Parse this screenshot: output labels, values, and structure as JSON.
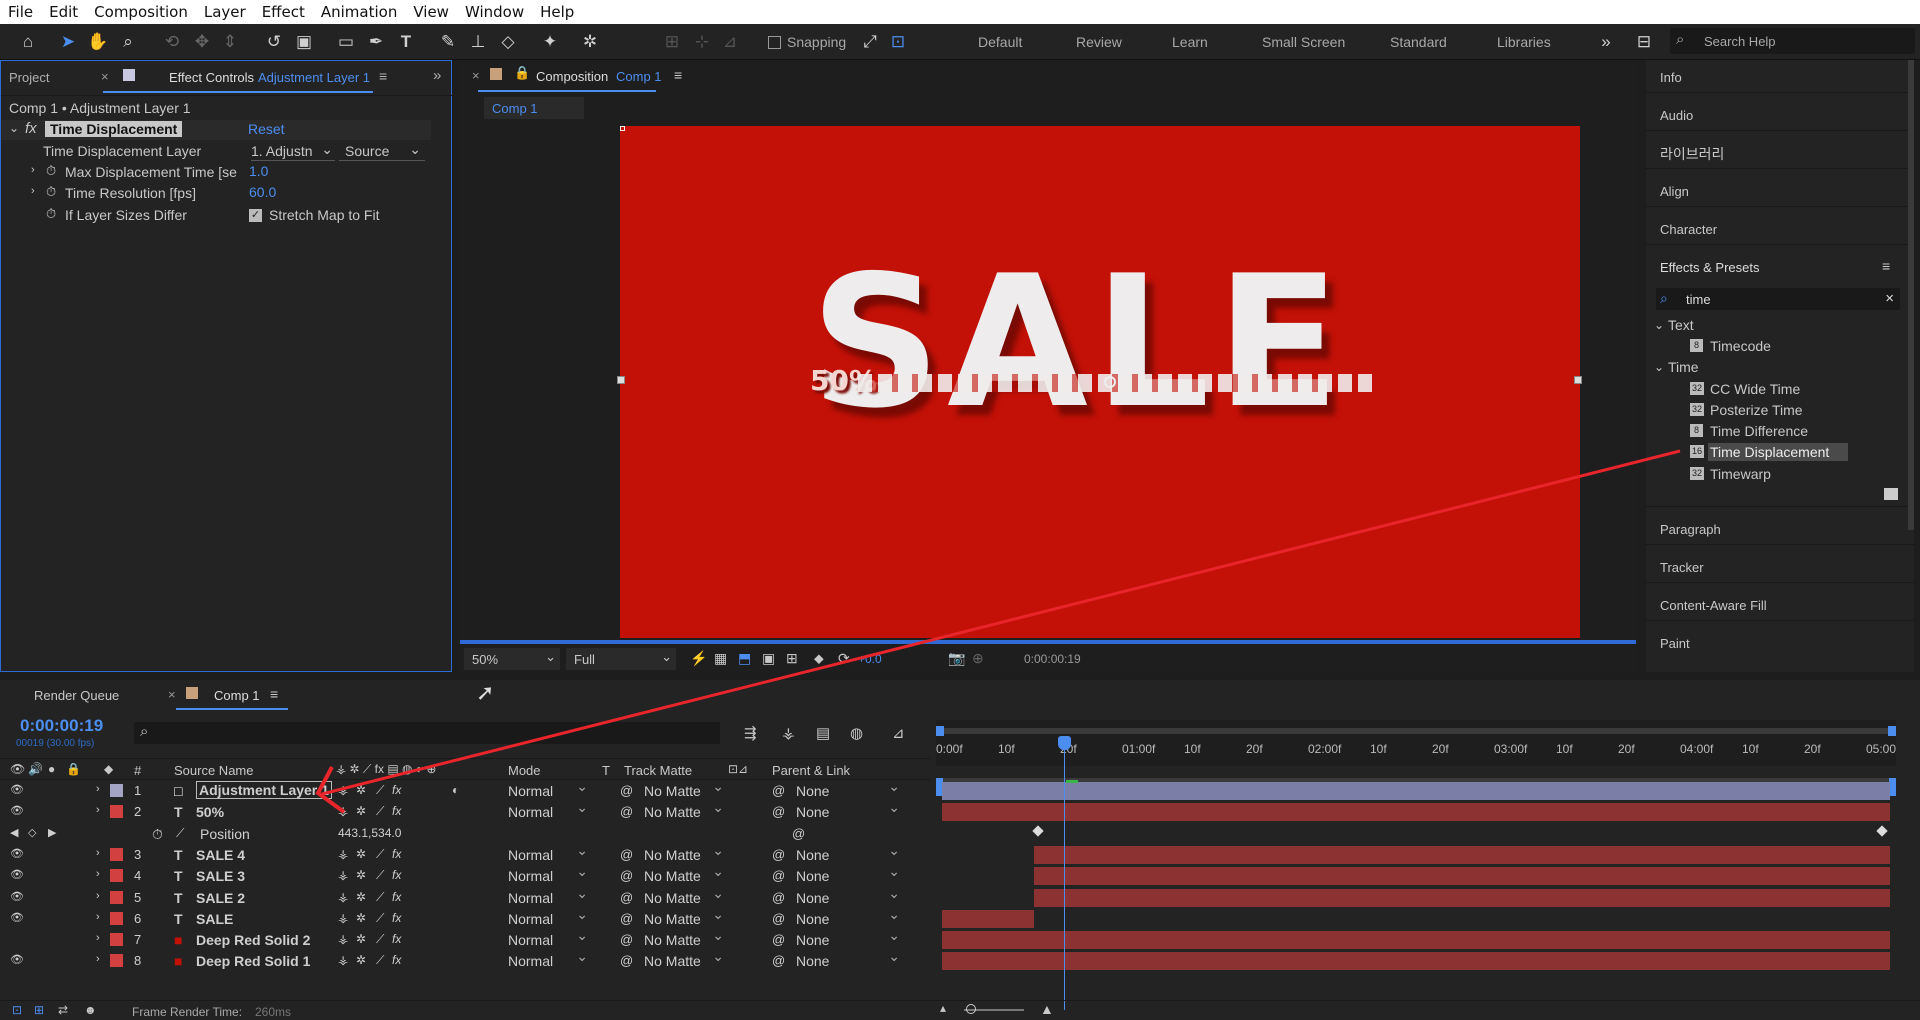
{
  "menu": [
    "File",
    "Edit",
    "Composition",
    "Layer",
    "Effect",
    "Animation",
    "View",
    "Window",
    "Help"
  ],
  "toolbar": {
    "snapping_label": "Snapping",
    "workspaces": [
      "Default",
      "Review",
      "Learn",
      "Small Screen",
      "Standard",
      "Libraries"
    ],
    "search_placeholder": "Search Help"
  },
  "left_panel": {
    "tab_project": "Project",
    "tab_effect_controls": "Effect Controls",
    "tab_effect_target": "Adjustment Layer 1",
    "breadcrumb": "Comp 1 • Adjustment Layer 1",
    "effect_name": "Time Displacement",
    "reset": "Reset",
    "props": [
      {
        "name": "Time Displacement Layer",
        "value": "1. Adjustn",
        "value2": "Source"
      },
      {
        "name": "Max Displacement Time [se",
        "value": "1.0"
      },
      {
        "name": "Time Resolution [fps]",
        "value": "60.0"
      },
      {
        "name": "If Layer Sizes Differ",
        "value": "Stretch Map to Fit"
      }
    ]
  },
  "composition": {
    "tab_prefix": "Composition",
    "tab_name": "Comp 1",
    "subtab": "Comp 1",
    "canvas_text": "SALE",
    "canvas_small": "50%",
    "canvas_color": "#c31107",
    "zoom": "50%",
    "resolution": "Full",
    "exposure": "+0.0",
    "timecode": "0:00:00:19"
  },
  "right_panel": {
    "items_top": [
      "Info",
      "Audio",
      "라이브러리",
      "Align",
      "Character"
    ],
    "effects_title": "Effects & Presets",
    "search_value": "time",
    "tree": [
      {
        "label": "Text",
        "type": "folder"
      },
      {
        "label": "Timecode",
        "type": "effect"
      },
      {
        "label": "Time",
        "type": "folder"
      },
      {
        "label": "CC Wide Time",
        "type": "effect"
      },
      {
        "label": "Posterize Time",
        "type": "effect"
      },
      {
        "label": "Time Difference",
        "type": "effect"
      },
      {
        "label": "Time Displacement",
        "type": "effect",
        "selected": true
      },
      {
        "label": "Timewarp",
        "type": "effect"
      }
    ],
    "items_bottom": [
      "Paragraph",
      "Tracker",
      "Content-Aware Fill",
      "Paint"
    ]
  },
  "timeline": {
    "tab_render": "Render Queue",
    "tab_comp": "Comp 1",
    "timecode": "0:00:00:19",
    "timecode_sub": "00019 (30.00 fps)",
    "headers": {
      "source": "Source Name",
      "mode": "Mode",
      "t": "T",
      "matte": "Track Matte",
      "parent": "Parent & Link",
      "num": "#"
    },
    "ruler": [
      "0:00f",
      "10f",
      "20f",
      "01:00f",
      "10f",
      "20f",
      "02:00f",
      "10f",
      "20f",
      "03:00f",
      "10f",
      "20f",
      "04:00f",
      "10f",
      "20f",
      "05:00"
    ],
    "layers": [
      {
        "num": "1",
        "name": "Adjustment Layer 1",
        "type": "adj",
        "color": "#a4a4c4",
        "mode": "Normal",
        "matte": "No Matte",
        "parent": "None"
      },
      {
        "num": "2",
        "name": "50%",
        "type": "text",
        "color": "#d24040",
        "mode": "Normal",
        "matte": "No Matte",
        "parent": "None"
      },
      {
        "num": "",
        "name": "Position",
        "type": "prop",
        "value": "443.1,534.0"
      },
      {
        "num": "3",
        "name": "SALE 4",
        "type": "text",
        "color": "#d24040",
        "mode": "Normal",
        "matte": "No Matte",
        "parent": "None"
      },
      {
        "num": "4",
        "name": "SALE 3",
        "type": "text",
        "color": "#d24040",
        "mode": "Normal",
        "matte": "No Matte",
        "parent": "None"
      },
      {
        "num": "5",
        "name": "SALE 2",
        "type": "text",
        "color": "#d24040",
        "mode": "Normal",
        "matte": "No Matte",
        "parent": "None"
      },
      {
        "num": "6",
        "name": "SALE",
        "type": "text",
        "color": "#d24040",
        "mode": "Normal",
        "matte": "No Matte",
        "parent": "None"
      },
      {
        "num": "7",
        "name": "Deep Red Solid 2",
        "type": "solid",
        "color": "#d24040",
        "mode": "Normal",
        "matte": "No Matte",
        "parent": "None"
      },
      {
        "num": "8",
        "name": "Deep Red Solid 1",
        "type": "solid",
        "color": "#d24040",
        "mode": "Normal",
        "matte": "No Matte",
        "parent": "None"
      }
    ],
    "footer": "Frame Render Time:",
    "footer_value": "260ms"
  }
}
